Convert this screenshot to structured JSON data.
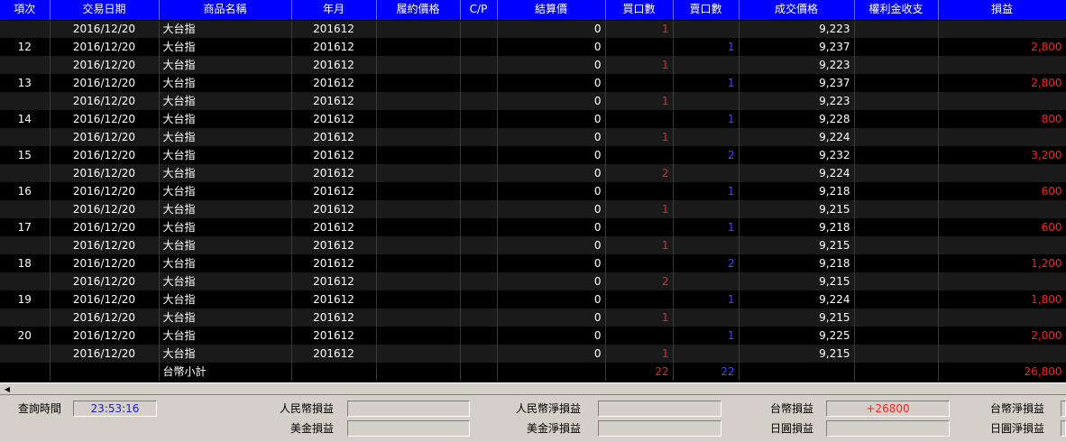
{
  "columns": [
    "項次",
    "交易日期",
    "商品名稱",
    "年月",
    "履約價格",
    "C/P",
    "結算價",
    "買口數",
    "賣口數",
    "成交價格",
    "權利金收支",
    "損益"
  ],
  "rows": [
    {
      "no": "",
      "date": "2016/12/20",
      "product": "大台指",
      "ym": "201612",
      "strike": "",
      "cp": "",
      "settle": "0",
      "buy": "1",
      "sell": "",
      "price": "9,223",
      "premium": "",
      "pnl": ""
    },
    {
      "no": "12",
      "date": "2016/12/20",
      "product": "大台指",
      "ym": "201612",
      "strike": "",
      "cp": "",
      "settle": "0",
      "buy": "",
      "sell": "1",
      "price": "9,237",
      "premium": "",
      "pnl": "2,800"
    },
    {
      "no": "",
      "date": "2016/12/20",
      "product": "大台指",
      "ym": "201612",
      "strike": "",
      "cp": "",
      "settle": "0",
      "buy": "1",
      "sell": "",
      "price": "9,223",
      "premium": "",
      "pnl": ""
    },
    {
      "no": "13",
      "date": "2016/12/20",
      "product": "大台指",
      "ym": "201612",
      "strike": "",
      "cp": "",
      "settle": "0",
      "buy": "",
      "sell": "1",
      "price": "9,237",
      "premium": "",
      "pnl": "2,800"
    },
    {
      "no": "",
      "date": "2016/12/20",
      "product": "大台指",
      "ym": "201612",
      "strike": "",
      "cp": "",
      "settle": "0",
      "buy": "1",
      "sell": "",
      "price": "9,223",
      "premium": "",
      "pnl": ""
    },
    {
      "no": "14",
      "date": "2016/12/20",
      "product": "大台指",
      "ym": "201612",
      "strike": "",
      "cp": "",
      "settle": "0",
      "buy": "",
      "sell": "1",
      "price": "9,228",
      "premium": "",
      "pnl": "800"
    },
    {
      "no": "",
      "date": "2016/12/20",
      "product": "大台指",
      "ym": "201612",
      "strike": "",
      "cp": "",
      "settle": "0",
      "buy": "1",
      "sell": "",
      "price": "9,224",
      "premium": "",
      "pnl": ""
    },
    {
      "no": "15",
      "date": "2016/12/20",
      "product": "大台指",
      "ym": "201612",
      "strike": "",
      "cp": "",
      "settle": "0",
      "buy": "",
      "sell": "2",
      "price": "9,232",
      "premium": "",
      "pnl": "3,200"
    },
    {
      "no": "",
      "date": "2016/12/20",
      "product": "大台指",
      "ym": "201612",
      "strike": "",
      "cp": "",
      "settle": "0",
      "buy": "2",
      "sell": "",
      "price": "9,224",
      "premium": "",
      "pnl": ""
    },
    {
      "no": "16",
      "date": "2016/12/20",
      "product": "大台指",
      "ym": "201612",
      "strike": "",
      "cp": "",
      "settle": "0",
      "buy": "",
      "sell": "1",
      "price": "9,218",
      "premium": "",
      "pnl": "600"
    },
    {
      "no": "",
      "date": "2016/12/20",
      "product": "大台指",
      "ym": "201612",
      "strike": "",
      "cp": "",
      "settle": "0",
      "buy": "1",
      "sell": "",
      "price": "9,215",
      "premium": "",
      "pnl": ""
    },
    {
      "no": "17",
      "date": "2016/12/20",
      "product": "大台指",
      "ym": "201612",
      "strike": "",
      "cp": "",
      "settle": "0",
      "buy": "",
      "sell": "1",
      "price": "9,218",
      "premium": "",
      "pnl": "600"
    },
    {
      "no": "",
      "date": "2016/12/20",
      "product": "大台指",
      "ym": "201612",
      "strike": "",
      "cp": "",
      "settle": "0",
      "buy": "1",
      "sell": "",
      "price": "9,215",
      "premium": "",
      "pnl": ""
    },
    {
      "no": "18",
      "date": "2016/12/20",
      "product": "大台指",
      "ym": "201612",
      "strike": "",
      "cp": "",
      "settle": "0",
      "buy": "",
      "sell": "2",
      "price": "9,218",
      "premium": "",
      "pnl": "1,200"
    },
    {
      "no": "",
      "date": "2016/12/20",
      "product": "大台指",
      "ym": "201612",
      "strike": "",
      "cp": "",
      "settle": "0",
      "buy": "2",
      "sell": "",
      "price": "9,215",
      "premium": "",
      "pnl": ""
    },
    {
      "no": "19",
      "date": "2016/12/20",
      "product": "大台指",
      "ym": "201612",
      "strike": "",
      "cp": "",
      "settle": "0",
      "buy": "",
      "sell": "1",
      "price": "9,224",
      "premium": "",
      "pnl": "1,800"
    },
    {
      "no": "",
      "date": "2016/12/20",
      "product": "大台指",
      "ym": "201612",
      "strike": "",
      "cp": "",
      "settle": "0",
      "buy": "1",
      "sell": "",
      "price": "9,215",
      "premium": "",
      "pnl": ""
    },
    {
      "no": "20",
      "date": "2016/12/20",
      "product": "大台指",
      "ym": "201612",
      "strike": "",
      "cp": "",
      "settle": "0",
      "buy": "",
      "sell": "1",
      "price": "9,225",
      "premium": "",
      "pnl": "2,000"
    },
    {
      "no": "",
      "date": "2016/12/20",
      "product": "大台指",
      "ym": "201612",
      "strike": "",
      "cp": "",
      "settle": "0",
      "buy": "1",
      "sell": "",
      "price": "9,215",
      "premium": "",
      "pnl": ""
    }
  ],
  "subtotal": {
    "label": "台幣小計",
    "buy": "22",
    "sell": "22",
    "pnl": "26,800"
  },
  "footer": {
    "query_time_label": "查詢時間",
    "query_time": "23:53:16",
    "rmb_pnl_label": "人民幣損益",
    "rmb_pnl": "",
    "rmb_net_label": "人民幣淨損益",
    "rmb_net": "",
    "twd_pnl_label": "台幣損益",
    "twd_pnl": "+26800",
    "twd_net_label": "台幣淨損益",
    "usd_pnl_label": "美金損益",
    "usd_pnl": "",
    "usd_net_label": "美金淨損益",
    "usd_net": "",
    "jpy_pnl_label": "日圓損益",
    "jpy_pnl": "",
    "jpy_net_label": "日圓淨損益"
  },
  "colors": {
    "header_bg": "#0000ff",
    "buy": "#ff1e1e",
    "sell": "#4646ff",
    "pnl": "#ff1e1e"
  },
  "icons": {
    "scroll_left": "left-arrow-icon"
  }
}
